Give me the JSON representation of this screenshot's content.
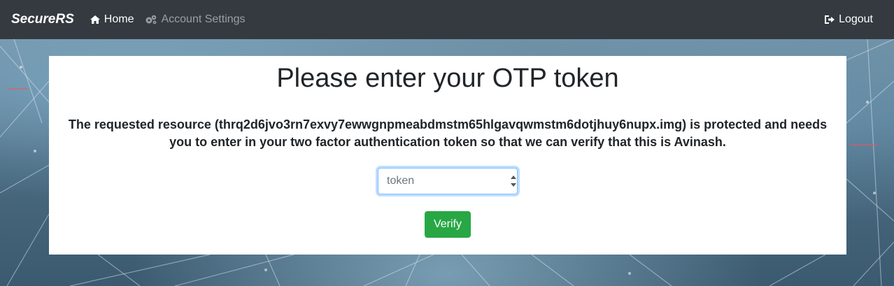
{
  "navbar": {
    "brand": "SecureRS",
    "home_label": "Home",
    "account_settings_label": "Account Settings",
    "logout_label": "Logout",
    "icons": {
      "home": "home-icon",
      "account_settings": "cogs-icon",
      "logout": "sign-out-icon"
    },
    "background": "#343a40"
  },
  "main": {
    "heading": "Please enter your OTP token",
    "message": "The requested resource (thrq2d6jvo3rn7exvy7ewwgnpmeabdmstm65hlgavqwmstm6dotjhuy6nupx.img) is protected and needs you to enter in your two factor authentication token so that we can verify that this is Avinash.",
    "token_input": {
      "placeholder": "token",
      "value": ""
    },
    "verify_label": "Verify"
  },
  "colors": {
    "verify_button": "#28a745",
    "input_focus_border": "#80bdff"
  }
}
